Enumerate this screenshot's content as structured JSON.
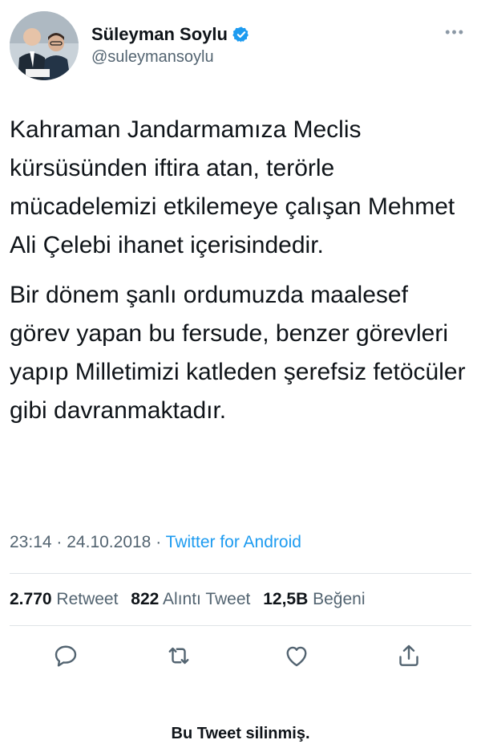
{
  "user": {
    "name": "Süleyman Soylu",
    "handle": "@suleymansoylu",
    "verified": true,
    "avatar_icon": "profile-photo"
  },
  "tweet": {
    "paragraphs": [
      "Kahraman Jandarmamıza Meclis kürsüsünden iftira atan, terörle mücadelemizi etkilemeye çalışan Mehmet Ali Çelebi ihanet içerisindedir.",
      "Bir dönem şanlı ordumuzda maalesef görev yapan bu fersude, benzer görevleri yapıp Milletimizi katleden şerefsiz fetöcüler gibi davranmaktadır."
    ],
    "time": "23:14",
    "date": "24.10.2018",
    "separator": "·",
    "source": "Twitter for Android"
  },
  "stats": {
    "retweets_count": "2.770",
    "retweets_label": "Retweet",
    "quotes_count": "822",
    "quotes_label": "Alıntı Tweet",
    "likes_count": "12,5B",
    "likes_label": "Beğeni"
  },
  "actions": {
    "icons": [
      "reply-icon",
      "retweet-icon",
      "like-icon",
      "share-icon"
    ]
  },
  "footer": {
    "deleted_note": "Bu Tweet silinmiş."
  },
  "colors": {
    "text": "#0f1419",
    "secondary": "#536471",
    "link": "#1d9bf0",
    "verified": "#1d9bf0",
    "divider": "#dfe3e7"
  }
}
